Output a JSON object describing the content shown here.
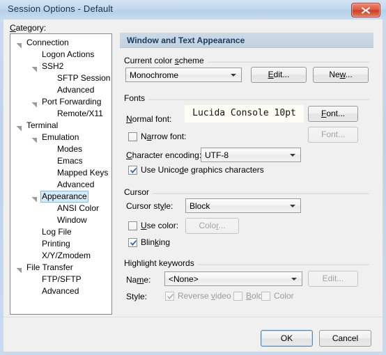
{
  "window": {
    "title": "Session Options - Default",
    "close_icon": "close-x-icon"
  },
  "sidebar": {
    "label": "Category:",
    "items": [
      {
        "label": "Connection",
        "indent": 0,
        "twisty": true,
        "selected": false
      },
      {
        "label": "Logon Actions",
        "indent": 1,
        "twisty": false,
        "selected": false
      },
      {
        "label": "SSH2",
        "indent": 1,
        "twisty": true,
        "selected": false
      },
      {
        "label": "SFTP Session",
        "indent": 2,
        "twisty": false,
        "selected": false
      },
      {
        "label": "Advanced",
        "indent": 2,
        "twisty": false,
        "selected": false
      },
      {
        "label": "Port Forwarding",
        "indent": 1,
        "twisty": true,
        "selected": false
      },
      {
        "label": "Remote/X11",
        "indent": 2,
        "twisty": false,
        "selected": false
      },
      {
        "label": "Terminal",
        "indent": 0,
        "twisty": true,
        "selected": false
      },
      {
        "label": "Emulation",
        "indent": 1,
        "twisty": true,
        "selected": false
      },
      {
        "label": "Modes",
        "indent": 2,
        "twisty": false,
        "selected": false
      },
      {
        "label": "Emacs",
        "indent": 2,
        "twisty": false,
        "selected": false
      },
      {
        "label": "Mapped Keys",
        "indent": 2,
        "twisty": false,
        "selected": false
      },
      {
        "label": "Advanced",
        "indent": 2,
        "twisty": false,
        "selected": false
      },
      {
        "label": "Appearance",
        "indent": 1,
        "twisty": true,
        "selected": true
      },
      {
        "label": "ANSI Color",
        "indent": 2,
        "twisty": false,
        "selected": false
      },
      {
        "label": "Window",
        "indent": 2,
        "twisty": false,
        "selected": false
      },
      {
        "label": "Log File",
        "indent": 1,
        "twisty": false,
        "selected": false
      },
      {
        "label": "Printing",
        "indent": 1,
        "twisty": false,
        "selected": false
      },
      {
        "label": "X/Y/Zmodem",
        "indent": 1,
        "twisty": false,
        "selected": false
      },
      {
        "label": "File Transfer",
        "indent": 0,
        "twisty": true,
        "selected": false
      },
      {
        "label": "FTP/SFTP",
        "indent": 1,
        "twisty": false,
        "selected": false
      },
      {
        "label": "Advanced",
        "indent": 1,
        "twisty": false,
        "selected": false
      }
    ]
  },
  "pane": {
    "header": "Window and Text Appearance",
    "color_scheme": {
      "group_title": "Current color scheme",
      "combo_value": "Monochrome",
      "edit_button": "Edit...",
      "new_button": "New..."
    },
    "fonts": {
      "group_title": "Fonts",
      "normal_font_label": "Normal font:",
      "normal_font_value": "Lucida Console 10pt",
      "normal_font_button": "Font...",
      "narrow_font_label": "Narrow font:",
      "narrow_font_checked": false,
      "narrow_font_button": "Font...",
      "char_encoding_label": "Character encoding:",
      "char_encoding_value": "UTF-8",
      "unicode_graphics_label": "Use Unicode graphics characters",
      "unicode_graphics_checked": true
    },
    "cursor": {
      "group_title": "Cursor",
      "style_label": "Cursor style:",
      "style_value": "Block",
      "use_color_label": "Use color:",
      "use_color_checked": false,
      "color_button": "Color...",
      "blinking_label": "Blinking",
      "blinking_checked": true
    },
    "highlight": {
      "group_title": "Highlight keywords",
      "name_label": "Name:",
      "name_value": "<None>",
      "edit_button": "Edit...",
      "style_label": "Style:",
      "reverse_video_label": "Reverse video",
      "reverse_video_checked": true,
      "bold_label": "Bold",
      "bold_checked": false,
      "color_label": "Color",
      "color_checked": false
    }
  },
  "footer": {
    "ok_button": "OK",
    "cancel_button": "Cancel"
  },
  "colors": {
    "titlebar_text": "#17334f",
    "pane_header_text": "#1c3c60",
    "close_button": "#cc3b26",
    "selection": "#d9eaf7",
    "check_blue": "#2b5f9e"
  }
}
